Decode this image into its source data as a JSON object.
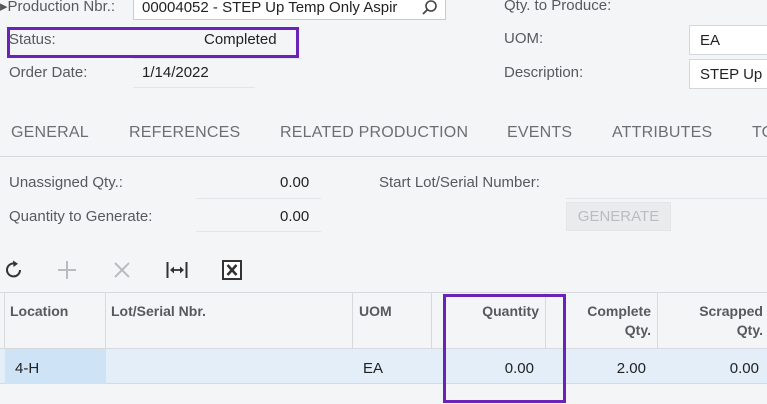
{
  "header": {
    "production_nbr_label": "Production Nbr.:",
    "production_nbr_value": "00004052 - STEP Up Temp Only Aspir",
    "status_label": "Status:",
    "status_value": "Completed",
    "order_date_label": "Order Date:",
    "order_date_value": "1/14/2022",
    "qty_to_produce_label": "Qty. to Produce:",
    "uom_label": "UOM:",
    "uom_value": "EA",
    "description_label": "Description:",
    "description_value": "STEP Up"
  },
  "tabs": [
    {
      "label": "GENERAL"
    },
    {
      "label": "REFERENCES"
    },
    {
      "label": "RELATED PRODUCTION"
    },
    {
      "label": "EVENTS"
    },
    {
      "label": "ATTRIBUTES"
    },
    {
      "label": "TO"
    }
  ],
  "panel": {
    "unassigned_qty_label": "Unassigned Qty.:",
    "unassigned_qty_value": "0.00",
    "qty_to_generate_label": "Quantity to Generate:",
    "qty_to_generate_value": "0.00",
    "start_lot_label": "Start Lot/Serial Number:",
    "generate_label": "GENERATE"
  },
  "toolbar": {
    "icons": [
      "refresh-icon",
      "add-icon",
      "delete-icon",
      "fit-columns-icon",
      "export-excel-icon"
    ]
  },
  "grid": {
    "columns": [
      "Location",
      "Lot/Serial Nbr.",
      "UOM",
      "Quantity",
      "Complete\nQty.",
      "Scrapped\nQty."
    ],
    "rows": [
      {
        "location": "4-H",
        "lot_serial": "",
        "uom": "EA",
        "quantity": "0.00",
        "complete_qty": "2.00",
        "scrapped_qty": "0.00"
      }
    ]
  },
  "colors": {
    "highlight": "#6b22b8",
    "selected_row": "#e4eef8",
    "selected_cell": "#cfe3f6"
  }
}
